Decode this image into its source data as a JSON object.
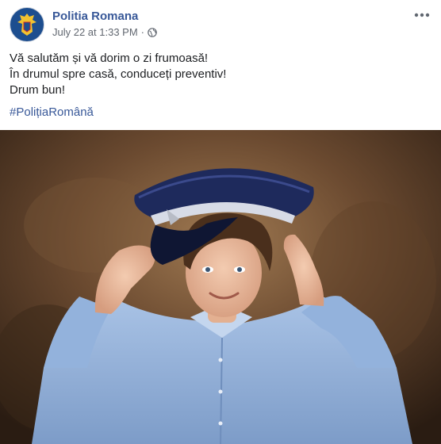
{
  "post": {
    "page_name": "Politia Romana",
    "timestamp": "July 22 at 1:33 PM",
    "separator": "·",
    "privacy_icon": "globe-icon",
    "more_icon": "more-horizontal-icon",
    "text_lines": [
      "Vă salutăm și vă dorim o zi frumoasă!",
      "În drumul spre casă, conduceți preventiv!",
      "Drum bun!"
    ],
    "hashtag": "#PolițiaRomână"
  },
  "photo": {
    "subject": "child-saluting-in-police-cap"
  },
  "colors": {
    "link": "#385898",
    "text": "#1c1e21",
    "meta": "#616770",
    "avatar_bg": "#1d4e8f",
    "shirt": "#8fb0d8",
    "cap": "#1e2a5c"
  }
}
